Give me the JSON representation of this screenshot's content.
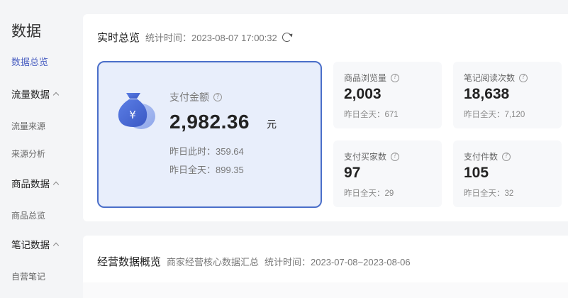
{
  "sidebar": {
    "title": "数据",
    "overview": "数据总览",
    "groups": [
      {
        "label": "流量数据",
        "items": [
          "流量来源",
          "来源分析"
        ]
      },
      {
        "label": "商品数据",
        "items": [
          "商品总览"
        ]
      },
      {
        "label": "笔记数据",
        "items": [
          "自营笔记"
        ]
      }
    ]
  },
  "realtime": {
    "title": "实时总览",
    "time_label": "统计时间：2023-08-07 17:00:32",
    "pay": {
      "label": "支付金额",
      "value": "2,982.36",
      "unit": "元",
      "sub1": "昨日此时：359.64",
      "sub2": "昨日全天：899.35"
    },
    "tiles": [
      {
        "label": "商品浏览量",
        "value": "2,003",
        "sub": "昨日全天：671"
      },
      {
        "label": "笔记阅读次数",
        "value": "18,638",
        "sub": "昨日全天：7,120"
      },
      {
        "label": "支付买家数",
        "value": "97",
        "sub": "昨日全天：29"
      },
      {
        "label": "支付件数",
        "value": "105",
        "sub": "昨日全天：32"
      }
    ]
  },
  "ops": {
    "title": "经营数据概览",
    "subtitle": "商家经营核心数据汇总",
    "time_label": "统计时间：2023-07-08~2023-08-06"
  },
  "colors": {
    "accent": "#4a6ec9",
    "active_nav": "#4a5fc1",
    "pay_bg": "#e8eefb"
  }
}
